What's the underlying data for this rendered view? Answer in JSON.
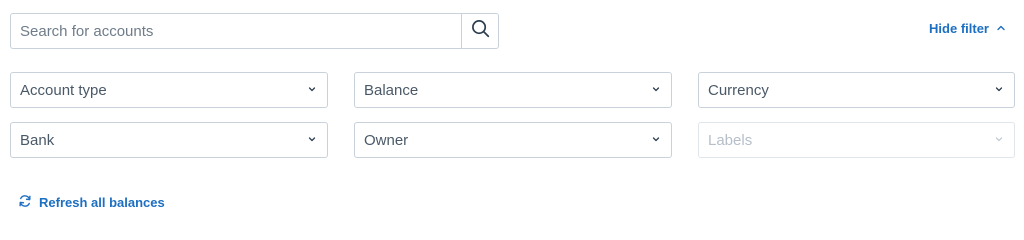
{
  "search": {
    "placeholder": "Search for accounts",
    "value": "",
    "icon": "search-icon"
  },
  "hide_filter": {
    "label": "Hide filter",
    "icon": "chevron-up-icon"
  },
  "filters": [
    {
      "label": "Account type",
      "disabled": false
    },
    {
      "label": "Balance",
      "disabled": false
    },
    {
      "label": "Currency",
      "disabled": false
    },
    {
      "label": "Bank",
      "disabled": false
    },
    {
      "label": "Owner",
      "disabled": false
    },
    {
      "label": "Labels",
      "disabled": true
    }
  ],
  "refresh": {
    "label": "Refresh all balances",
    "icon": "refresh-icon"
  },
  "colors": {
    "accent": "#1d6fc1",
    "border": "#c9d1da",
    "text": "#4a5968",
    "disabled_text": "#b6bfc8"
  }
}
